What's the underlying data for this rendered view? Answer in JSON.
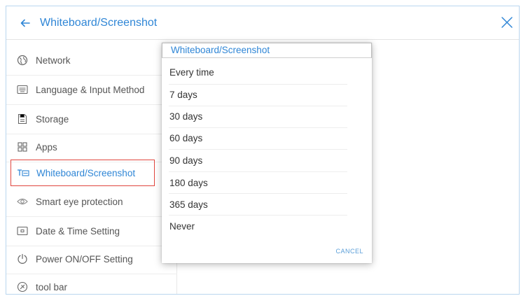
{
  "header": {
    "title": "Whiteboard/Screenshot"
  },
  "sidebar": {
    "items": [
      {
        "label": "Network",
        "icon": "globe-icon"
      },
      {
        "label": "Language & Input Method",
        "icon": "keyboard-icon"
      },
      {
        "label": "Storage",
        "icon": "storage-icon"
      },
      {
        "label": "Apps",
        "icon": "apps-grid-icon"
      },
      {
        "label": "Whiteboard/Screenshot",
        "icon": "whiteboard-icon",
        "selected": true
      },
      {
        "label": "Smart eye protection",
        "icon": "eye-icon"
      },
      {
        "label": "Date & Time Setting",
        "icon": "calendar-icon"
      },
      {
        "label": "Power ON/OFF Setting",
        "icon": "power-icon"
      },
      {
        "label": "tool bar",
        "icon": "toolbar-icon"
      }
    ]
  },
  "dialog": {
    "title": "Whiteboard/Screenshot",
    "options": [
      "Every time",
      "7 days",
      "30 days",
      "60 days",
      "90 days",
      "180 days",
      "365 days",
      "Never"
    ],
    "cancel_label": "CANCEL"
  },
  "colors": {
    "accent": "#2f86d6",
    "selection_border": "#e0463f",
    "text": "#555555"
  }
}
